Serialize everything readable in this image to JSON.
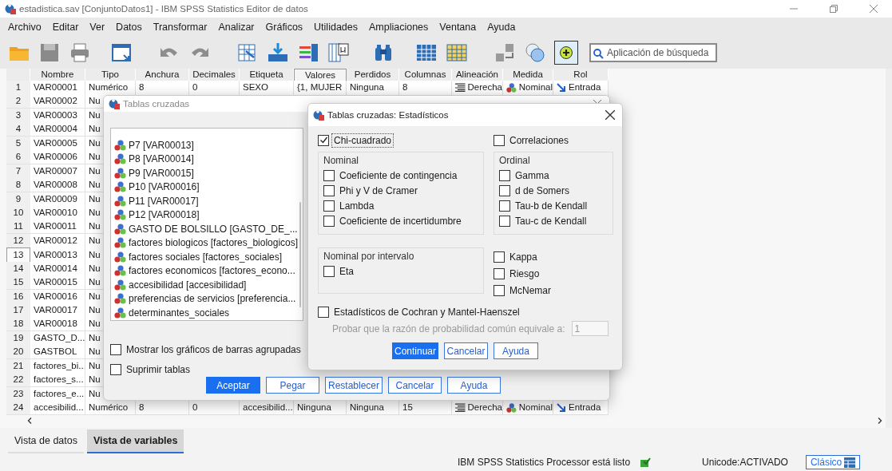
{
  "window": {
    "title": "estadistica.sav [ConjuntoDatos1] - IBM SPSS Statistics Editor de datos"
  },
  "menu": [
    "Archivo",
    "Editar",
    "Ver",
    "Datos",
    "Transformar",
    "Analizar",
    "Gráficos",
    "Utilidades",
    "Ampliaciones",
    "Ventana",
    "Ayuda"
  ],
  "search": {
    "placeholder": "Aplicación de búsqueda"
  },
  "grid": {
    "columns": [
      {
        "label": "Nombre",
        "kind": "text",
        "selected": false
      },
      {
        "label": "Tipo",
        "kind": "text",
        "selected": false
      },
      {
        "label": "Anchura",
        "kind": "text",
        "selected": false
      },
      {
        "label": "Decimales",
        "kind": "text",
        "selected": false
      },
      {
        "label": "Etiqueta",
        "kind": "text",
        "selected": false
      },
      {
        "label": "Valores",
        "kind": "text",
        "selected": true
      },
      {
        "label": "Perdidos",
        "kind": "text",
        "selected": false
      },
      {
        "label": "Columnas",
        "kind": "text",
        "selected": false
      },
      {
        "label": "Alineación",
        "kind": "align",
        "selected": false
      },
      {
        "label": "Medida",
        "kind": "measure",
        "selected": false
      },
      {
        "label": "Rol",
        "kind": "role",
        "selected": false
      }
    ],
    "rows": [
      {
        "num": "1",
        "selected": false,
        "cells": [
          "VAR00001",
          "Numérico",
          "8",
          "0",
          "SEXO",
          "{1, MUJER",
          "Ninguna",
          "8",
          "Derecha",
          "Nominal",
          "Entrada"
        ]
      },
      {
        "num": "2",
        "selected": false,
        "cells": [
          "VAR00002",
          "Nu"
        ]
      },
      {
        "num": "3",
        "selected": false,
        "cells": [
          "VAR00003",
          "Nu"
        ]
      },
      {
        "num": "4",
        "selected": false,
        "cells": [
          "VAR00004",
          "Nu"
        ]
      },
      {
        "num": "5",
        "selected": false,
        "cells": [
          "VAR00005",
          "Nu"
        ]
      },
      {
        "num": "6",
        "selected": false,
        "cells": [
          "VAR00006",
          "Nu"
        ]
      },
      {
        "num": "7",
        "selected": false,
        "cells": [
          "VAR00007",
          "Nu"
        ]
      },
      {
        "num": "8",
        "selected": false,
        "cells": [
          "VAR00008",
          "Nu"
        ]
      },
      {
        "num": "9",
        "selected": false,
        "cells": [
          "VAR00009",
          "Nu"
        ]
      },
      {
        "num": "10",
        "selected": false,
        "cells": [
          "VAR00010",
          "Nu"
        ]
      },
      {
        "num": "11",
        "selected": false,
        "cells": [
          "VAR00011",
          "Nu"
        ]
      },
      {
        "num": "12",
        "selected": false,
        "cells": [
          "VAR00012",
          "Nu"
        ]
      },
      {
        "num": "13",
        "selected": true,
        "cells": [
          "VAR00013",
          "Nu"
        ]
      },
      {
        "num": "14",
        "selected": false,
        "cells": [
          "VAR00014",
          "Nu"
        ]
      },
      {
        "num": "15",
        "selected": false,
        "cells": [
          "VAR00015",
          "Nu"
        ]
      },
      {
        "num": "16",
        "selected": false,
        "cells": [
          "VAR00016",
          "Nu"
        ]
      },
      {
        "num": "17",
        "selected": false,
        "cells": [
          "VAR00017",
          "Nu"
        ]
      },
      {
        "num": "18",
        "selected": false,
        "cells": [
          "VAR00018",
          "Nu"
        ]
      },
      {
        "num": "19",
        "selected": false,
        "cells": [
          "GASTO_D...",
          "Nu"
        ]
      },
      {
        "num": "20",
        "selected": false,
        "cells": [
          "GASTBOL",
          "Nu"
        ]
      },
      {
        "num": "21",
        "selected": false,
        "cells": [
          "factores_bi...",
          "Nu"
        ]
      },
      {
        "num": "22",
        "selected": false,
        "cells": [
          "factores_s...",
          "Nu"
        ]
      },
      {
        "num": "23",
        "selected": false,
        "cells": [
          "factores_e...",
          "Nu"
        ]
      },
      {
        "num": "24",
        "selected": false,
        "cells": [
          "accesibilid...",
          "Numérico",
          "8",
          "0",
          "accesibilid...",
          "Ninguna",
          "Ninguna",
          "15",
          "Derecha",
          "Nominal",
          "Entrada"
        ]
      }
    ]
  },
  "crosstabs_dialog": {
    "title": "Tablas cruzadas",
    "variables": [
      "P7 [VAR00013]",
      "P8 [VAR00014]",
      "P9 [VAR00015]",
      "P10 [VAR00016]",
      "P11 [VAR00017]",
      "P12 [VAR00018]",
      "GASTO DE BOLSILLO [GASTO_DE_...",
      "factores biologicos [factores_biologicos]",
      "factores sociales [factores_sociales]",
      "factores economicos [factores_econo...",
      "accesibilidad [accesibilidad]",
      "preferencias de servicios  [preferencia...",
      "determinantes_sociales"
    ],
    "options": [
      {
        "label": "Mostrar los gráficos de barras agrupadas",
        "checked": false
      },
      {
        "label": "Suprimir tablas",
        "checked": false
      }
    ],
    "buttons": [
      {
        "label": "Aceptar",
        "primary": true
      },
      {
        "label": "Pegar",
        "primary": false
      },
      {
        "label": "Restablecer",
        "primary": false
      },
      {
        "label": "Cancelar",
        "primary": false
      },
      {
        "label": "Ayuda",
        "primary": false
      }
    ]
  },
  "statistics_dialog": {
    "title": "Tablas cruzadas: Estadísticos",
    "top": [
      {
        "label": "Chi-cuadrado",
        "checked": true,
        "focused": true
      },
      {
        "label": "Correlaciones",
        "checked": false,
        "focused": false
      }
    ],
    "groups": [
      {
        "title": "Nominal",
        "items": [
          {
            "label": "Coeficiente de contingencia",
            "checked": false
          },
          {
            "label": "Phi y V de Cramer",
            "checked": false
          },
          {
            "label": "Lambda",
            "checked": false
          },
          {
            "label": "Coeficiente de incertidumbre",
            "checked": false
          }
        ]
      },
      {
        "title": "Ordinal",
        "items": [
          {
            "label": "Gamma",
            "checked": false
          },
          {
            "label": "d de Somers",
            "checked": false
          },
          {
            "label": "Tau-b de Kendall",
            "checked": false
          },
          {
            "label": "Tau-c de Kendall",
            "checked": false
          }
        ]
      },
      {
        "title": "Nominal por intervalo",
        "items": [
          {
            "label": "Eta",
            "checked": false
          }
        ]
      }
    ],
    "extra": [
      {
        "label": "Kappa",
        "checked": false
      },
      {
        "label": "Riesgo",
        "checked": false
      },
      {
        "label": "McNemar",
        "checked": false
      }
    ],
    "cochran": {
      "label": "Estadísticos de Cochran y Mantel-Haenszel",
      "checked": false
    },
    "ratio_test": {
      "label": "Probar que la razón de probabilidad común equivale a:",
      "value": "1",
      "disabled": true
    },
    "buttons": [
      {
        "label": "Continuar",
        "primary": true
      },
      {
        "label": "Cancelar",
        "primary": false
      },
      {
        "label": "Ayuda",
        "primary": false
      }
    ]
  },
  "view_tabs": [
    {
      "label": "Vista de datos",
      "selected": false
    },
    {
      "label": "Vista de variables",
      "selected": true
    }
  ],
  "status": {
    "message": "IBM SPSS Statistics Processor está listo",
    "unicode": "Unicode:ACTIVADO",
    "mode": "Clásico"
  }
}
